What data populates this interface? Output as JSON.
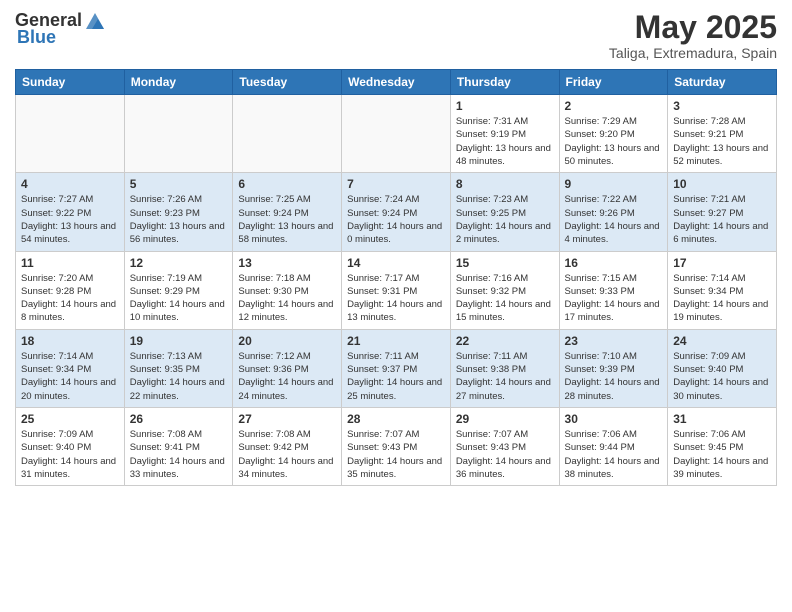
{
  "header": {
    "logo_general": "General",
    "logo_blue": "Blue",
    "month_title": "May 2025",
    "location": "Taliga, Extremadura, Spain"
  },
  "days_of_week": [
    "Sunday",
    "Monday",
    "Tuesday",
    "Wednesday",
    "Thursday",
    "Friday",
    "Saturday"
  ],
  "weeks": [
    [
      {
        "day": "",
        "empty": true
      },
      {
        "day": "",
        "empty": true
      },
      {
        "day": "",
        "empty": true
      },
      {
        "day": "",
        "empty": true
      },
      {
        "day": "1",
        "sunrise": "7:31 AM",
        "sunset": "9:19 PM",
        "daylight": "13 hours and 48 minutes."
      },
      {
        "day": "2",
        "sunrise": "7:29 AM",
        "sunset": "9:20 PM",
        "daylight": "13 hours and 50 minutes."
      },
      {
        "day": "3",
        "sunrise": "7:28 AM",
        "sunset": "9:21 PM",
        "daylight": "13 hours and 52 minutes."
      }
    ],
    [
      {
        "day": "4",
        "sunrise": "7:27 AM",
        "sunset": "9:22 PM",
        "daylight": "13 hours and 54 minutes."
      },
      {
        "day": "5",
        "sunrise": "7:26 AM",
        "sunset": "9:23 PM",
        "daylight": "13 hours and 56 minutes."
      },
      {
        "day": "6",
        "sunrise": "7:25 AM",
        "sunset": "9:24 PM",
        "daylight": "13 hours and 58 minutes."
      },
      {
        "day": "7",
        "sunrise": "7:24 AM",
        "sunset": "9:24 PM",
        "daylight": "14 hours and 0 minutes."
      },
      {
        "day": "8",
        "sunrise": "7:23 AM",
        "sunset": "9:25 PM",
        "daylight": "14 hours and 2 minutes."
      },
      {
        "day": "9",
        "sunrise": "7:22 AM",
        "sunset": "9:26 PM",
        "daylight": "14 hours and 4 minutes."
      },
      {
        "day": "10",
        "sunrise": "7:21 AM",
        "sunset": "9:27 PM",
        "daylight": "14 hours and 6 minutes."
      }
    ],
    [
      {
        "day": "11",
        "sunrise": "7:20 AM",
        "sunset": "9:28 PM",
        "daylight": "14 hours and 8 minutes."
      },
      {
        "day": "12",
        "sunrise": "7:19 AM",
        "sunset": "9:29 PM",
        "daylight": "14 hours and 10 minutes."
      },
      {
        "day": "13",
        "sunrise": "7:18 AM",
        "sunset": "9:30 PM",
        "daylight": "14 hours and 12 minutes."
      },
      {
        "day": "14",
        "sunrise": "7:17 AM",
        "sunset": "9:31 PM",
        "daylight": "14 hours and 13 minutes."
      },
      {
        "day": "15",
        "sunrise": "7:16 AM",
        "sunset": "9:32 PM",
        "daylight": "14 hours and 15 minutes."
      },
      {
        "day": "16",
        "sunrise": "7:15 AM",
        "sunset": "9:33 PM",
        "daylight": "14 hours and 17 minutes."
      },
      {
        "day": "17",
        "sunrise": "7:14 AM",
        "sunset": "9:34 PM",
        "daylight": "14 hours and 19 minutes."
      }
    ],
    [
      {
        "day": "18",
        "sunrise": "7:14 AM",
        "sunset": "9:34 PM",
        "daylight": "14 hours and 20 minutes."
      },
      {
        "day": "19",
        "sunrise": "7:13 AM",
        "sunset": "9:35 PM",
        "daylight": "14 hours and 22 minutes."
      },
      {
        "day": "20",
        "sunrise": "7:12 AM",
        "sunset": "9:36 PM",
        "daylight": "14 hours and 24 minutes."
      },
      {
        "day": "21",
        "sunrise": "7:11 AM",
        "sunset": "9:37 PM",
        "daylight": "14 hours and 25 minutes."
      },
      {
        "day": "22",
        "sunrise": "7:11 AM",
        "sunset": "9:38 PM",
        "daylight": "14 hours and 27 minutes."
      },
      {
        "day": "23",
        "sunrise": "7:10 AM",
        "sunset": "9:39 PM",
        "daylight": "14 hours and 28 minutes."
      },
      {
        "day": "24",
        "sunrise": "7:09 AM",
        "sunset": "9:40 PM",
        "daylight": "14 hours and 30 minutes."
      }
    ],
    [
      {
        "day": "25",
        "sunrise": "7:09 AM",
        "sunset": "9:40 PM",
        "daylight": "14 hours and 31 minutes."
      },
      {
        "day": "26",
        "sunrise": "7:08 AM",
        "sunset": "9:41 PM",
        "daylight": "14 hours and 33 minutes."
      },
      {
        "day": "27",
        "sunrise": "7:08 AM",
        "sunset": "9:42 PM",
        "daylight": "14 hours and 34 minutes."
      },
      {
        "day": "28",
        "sunrise": "7:07 AM",
        "sunset": "9:43 PM",
        "daylight": "14 hours and 35 minutes."
      },
      {
        "day": "29",
        "sunrise": "7:07 AM",
        "sunset": "9:43 PM",
        "daylight": "14 hours and 36 minutes."
      },
      {
        "day": "30",
        "sunrise": "7:06 AM",
        "sunset": "9:44 PM",
        "daylight": "14 hours and 38 minutes."
      },
      {
        "day": "31",
        "sunrise": "7:06 AM",
        "sunset": "9:45 PM",
        "daylight": "14 hours and 39 minutes."
      }
    ]
  ]
}
